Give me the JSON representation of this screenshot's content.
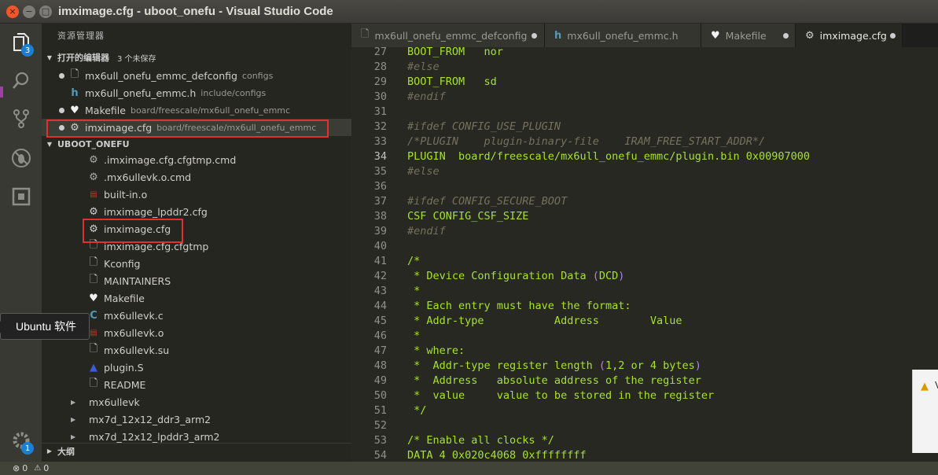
{
  "window": {
    "title": "imximage.cfg - uboot_onefu - Visual Studio Code",
    "close": "×",
    "minimize": "−",
    "maximize": "□"
  },
  "activity_bar": {
    "explorer_badge": "3",
    "settings_badge": "1"
  },
  "sidebar": {
    "title": "资源管理器",
    "open_editors": {
      "label": "打开的编辑器",
      "unsaved": "3 个未保存",
      "items": [
        {
          "name": "mx6ull_onefu_emmc_defconfig",
          "path": "configs",
          "icon": "file-icon"
        },
        {
          "name": "mx6ull_onefu_emmc.h",
          "path": "include/configs",
          "icon": "h-file-icon"
        },
        {
          "name": "Makefile",
          "path": "board/freescale/mx6ull_onefu_emmc",
          "icon": "makefile-icon"
        },
        {
          "name": "imximage.cfg",
          "path": "board/freescale/mx6ull_onefu_emmc",
          "icon": "gear-icon"
        }
      ]
    },
    "project": {
      "label": "UBOOT_ONEFU",
      "files": [
        {
          "name": ".imximage.cfg.cfgtmp.cmd",
          "icon": "gears-icon"
        },
        {
          "name": ".mx6ullevk.o.cmd",
          "icon": "gears-icon"
        },
        {
          "name": "built-in.o",
          "icon": "binary-icon"
        },
        {
          "name": "imximage_lpddr2.cfg",
          "icon": "gear-icon"
        },
        {
          "name": "imximage.cfg",
          "icon": "gear-icon"
        },
        {
          "name": "imximage.cfg.cfgtmp",
          "icon": "file-icon"
        },
        {
          "name": "Kconfig",
          "icon": "file-icon"
        },
        {
          "name": "MAINTAINERS",
          "icon": "file-icon"
        },
        {
          "name": "Makefile",
          "icon": "makefile-icon"
        },
        {
          "name": "mx6ullevk.c",
          "icon": "c-file-icon"
        },
        {
          "name": "mx6ullevk.o",
          "icon": "binary-icon"
        },
        {
          "name": "mx6ullevk.su",
          "icon": "file-icon"
        },
        {
          "name": "plugin.S",
          "icon": "asm-icon"
        },
        {
          "name": "README",
          "icon": "file-icon"
        }
      ],
      "folders": [
        {
          "name": "mx6ullevk"
        },
        {
          "name": "mx7d_12x12_ddr3_arm2"
        },
        {
          "name": "mx7d_12x12_lpddr3_arm2"
        }
      ]
    },
    "outline": {
      "label": "大纲"
    }
  },
  "tooltip": {
    "text": "Ubuntu 软件"
  },
  "tabs": [
    {
      "label": "mx6ull_onefu_emmc_defconfig",
      "icon": "file-icon"
    },
    {
      "label": "mx6ull_onefu_emmc.h",
      "icon": "h-file-icon"
    },
    {
      "label": "Makefile",
      "icon": "makefile-icon"
    },
    {
      "label": "imximage.cfg",
      "icon": "gear-icon"
    }
  ],
  "code": [
    {
      "n": "27",
      "parts": [
        [
          "kw",
          "BOOT_FROM   nor"
        ]
      ]
    },
    {
      "n": "28",
      "parts": [
        [
          "cm",
          "#else"
        ]
      ]
    },
    {
      "n": "29",
      "parts": [
        [
          "kw",
          "BOOT_FROM   sd"
        ]
      ]
    },
    {
      "n": "30",
      "parts": [
        [
          "cm",
          "#endif"
        ]
      ]
    },
    {
      "n": "31",
      "parts": []
    },
    {
      "n": "32",
      "parts": [
        [
          "cm",
          "#ifdef CONFIG_USE_PLUGIN"
        ]
      ]
    },
    {
      "n": "33",
      "parts": [
        [
          "cm",
          "/*PLUGIN    plugin-binary-file    IRAM_FREE_START_ADDR*/"
        ]
      ]
    },
    {
      "n": "34",
      "parts": [
        [
          "kw",
          "PLUGIN  board/freescale/mx6ull_onefu_emmc/plugin.bin 0x00907000"
        ]
      ]
    },
    {
      "n": "35",
      "parts": [
        [
          "cm",
          "#else"
        ]
      ]
    },
    {
      "n": "36",
      "parts": []
    },
    {
      "n": "37",
      "parts": [
        [
          "cm",
          "#ifdef CONFIG_SECURE_BOOT"
        ]
      ]
    },
    {
      "n": "38",
      "parts": [
        [
          "kw",
          "CSF CONFIG_CSF_SIZE"
        ]
      ]
    },
    {
      "n": "39",
      "parts": [
        [
          "cm",
          "#endif"
        ]
      ]
    },
    {
      "n": "40",
      "parts": []
    },
    {
      "n": "41",
      "parts": [
        [
          "kw",
          "/*"
        ]
      ]
    },
    {
      "n": "42",
      "parts": [
        [
          "kw",
          " * Device Configuration Data "
        ],
        [
          "nm",
          "("
        ],
        [
          "kw",
          "DCD"
        ],
        [
          "nm",
          ")"
        ]
      ]
    },
    {
      "n": "43",
      "parts": [
        [
          "kw",
          " *"
        ]
      ]
    },
    {
      "n": "44",
      "parts": [
        [
          "kw",
          " * Each entry must have the format:"
        ]
      ]
    },
    {
      "n": "45",
      "parts": [
        [
          "kw",
          " * Addr-type           Address        Value"
        ]
      ]
    },
    {
      "n": "46",
      "parts": [
        [
          "kw",
          " *"
        ]
      ]
    },
    {
      "n": "47",
      "parts": [
        [
          "kw",
          " * where:"
        ]
      ]
    },
    {
      "n": "48",
      "parts": [
        [
          "kw",
          " *  Addr-type register length "
        ],
        [
          "nm",
          "("
        ],
        [
          "kw",
          "1,2 or 4 bytes"
        ],
        [
          "nm",
          ")"
        ]
      ]
    },
    {
      "n": "49",
      "parts": [
        [
          "kw",
          " *  Address   absolute address of the register"
        ]
      ]
    },
    {
      "n": "50",
      "parts": [
        [
          "kw",
          " *  value     value to be stored in the register"
        ]
      ]
    },
    {
      "n": "51",
      "parts": [
        [
          "kw",
          " */"
        ]
      ]
    },
    {
      "n": "52",
      "parts": []
    },
    {
      "n": "53",
      "parts": [
        [
          "kw",
          "/* Enable all clocks */"
        ]
      ]
    },
    {
      "n": "54",
      "parts": [
        [
          "kw",
          "DATA 4 0x020c4068 0xffffffff"
        ]
      ]
    }
  ],
  "status": {
    "errors": "0",
    "warnings": "0"
  },
  "notification": {
    "text": "V"
  },
  "colors": {
    "highlight": "#e0312e",
    "keyword": "#a6e22e",
    "comment": "#75715e",
    "number": "#ae81ff"
  }
}
